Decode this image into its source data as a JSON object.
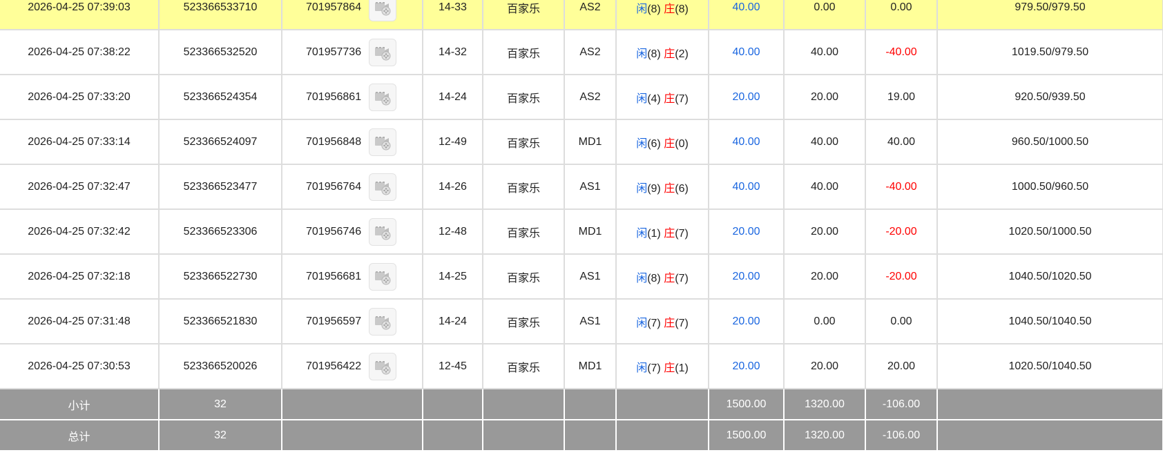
{
  "rows": [
    {
      "time": "2026-04-25 07:39:03",
      "bet_id": "523366533710",
      "round": "701957864",
      "shoe": "14-33",
      "game": "百家乐",
      "table": "AS2",
      "player_label": "闲",
      "player_pts": "(8)",
      "banker_label": "庄",
      "banker_pts": "(8)",
      "bet": "40.00",
      "valid": "0.00",
      "win": "0.00",
      "win_color": "#222222",
      "balance": "979.50/979.50"
    },
    {
      "time": "2026-04-25 07:38:22",
      "bet_id": "523366532520",
      "round": "701957736",
      "shoe": "14-32",
      "game": "百家乐",
      "table": "AS2",
      "player_label": "闲",
      "player_pts": "(8)",
      "banker_label": "庄",
      "banker_pts": "(2)",
      "bet": "40.00",
      "valid": "40.00",
      "win": "-40.00",
      "win_color": "#ff0000",
      "balance": "1019.50/979.50"
    },
    {
      "time": "2026-04-25 07:33:20",
      "bet_id": "523366524354",
      "round": "701956861",
      "shoe": "14-24",
      "game": "百家乐",
      "table": "AS2",
      "player_label": "闲",
      "player_pts": "(4)",
      "banker_label": "庄",
      "banker_pts": "(7)",
      "bet": "20.00",
      "valid": "20.00",
      "win": "19.00",
      "win_color": "#222222",
      "balance": "920.50/939.50"
    },
    {
      "time": "2026-04-25 07:33:14",
      "bet_id": "523366524097",
      "round": "701956848",
      "shoe": "12-49",
      "game": "百家乐",
      "table": "MD1",
      "player_label": "闲",
      "player_pts": "(6)",
      "banker_label": "庄",
      "banker_pts": "(0)",
      "bet": "40.00",
      "valid": "40.00",
      "win": "40.00",
      "win_color": "#222222",
      "balance": "960.50/1000.50"
    },
    {
      "time": "2026-04-25 07:32:47",
      "bet_id": "523366523477",
      "round": "701956764",
      "shoe": "14-26",
      "game": "百家乐",
      "table": "AS1",
      "player_label": "闲",
      "player_pts": "(9)",
      "banker_label": "庄",
      "banker_pts": "(6)",
      "bet": "40.00",
      "valid": "40.00",
      "win": "-40.00",
      "win_color": "#ff0000",
      "balance": "1000.50/960.50"
    },
    {
      "time": "2026-04-25 07:32:42",
      "bet_id": "523366523306",
      "round": "701956746",
      "shoe": "12-48",
      "game": "百家乐",
      "table": "MD1",
      "player_label": "闲",
      "player_pts": "(1)",
      "banker_label": "庄",
      "banker_pts": "(7)",
      "bet": "20.00",
      "valid": "20.00",
      "win": "-20.00",
      "win_color": "#ff0000",
      "balance": "1020.50/1000.50"
    },
    {
      "time": "2026-04-25 07:32:18",
      "bet_id": "523366522730",
      "round": "701956681",
      "shoe": "14-25",
      "game": "百家乐",
      "table": "AS1",
      "player_label": "闲",
      "player_pts": "(8)",
      "banker_label": "庄",
      "banker_pts": "(7)",
      "bet": "20.00",
      "valid": "20.00",
      "win": "-20.00",
      "win_color": "#ff0000",
      "balance": "1040.50/1020.50"
    },
    {
      "time": "2026-04-25 07:31:48",
      "bet_id": "523366521830",
      "round": "701956597",
      "shoe": "14-24",
      "game": "百家乐",
      "table": "AS1",
      "player_label": "闲",
      "player_pts": "(7)",
      "banker_label": "庄",
      "banker_pts": "(7)",
      "bet": "20.00",
      "valid": "0.00",
      "win": "0.00",
      "win_color": "#222222",
      "balance": "1040.50/1040.50"
    },
    {
      "time": "2026-04-25 07:30:53",
      "bet_id": "523366520026",
      "round": "701956422",
      "shoe": "12-45",
      "game": "百家乐",
      "table": "MD1",
      "player_label": "闲",
      "player_pts": "(7)",
      "banker_label": "庄",
      "banker_pts": "(1)",
      "bet": "20.00",
      "valid": "20.00",
      "win": "20.00",
      "win_color": "#222222",
      "balance": "1020.50/1040.50"
    }
  ],
  "subtotal": {
    "label": "小计",
    "count": "32",
    "bet": "1500.00",
    "valid": "1320.00",
    "win": "-106.00"
  },
  "total": {
    "label": "总计",
    "count": "32",
    "bet": "1500.00",
    "valid": "1320.00",
    "win": "-106.00"
  },
  "colors": {
    "highlight_row": "#ffff99",
    "summary_bg": "#999999",
    "bet_blue": "#1a66e0",
    "loss_red": "#ff0000"
  },
  "icons": {
    "replay": "video-replay-icon"
  }
}
